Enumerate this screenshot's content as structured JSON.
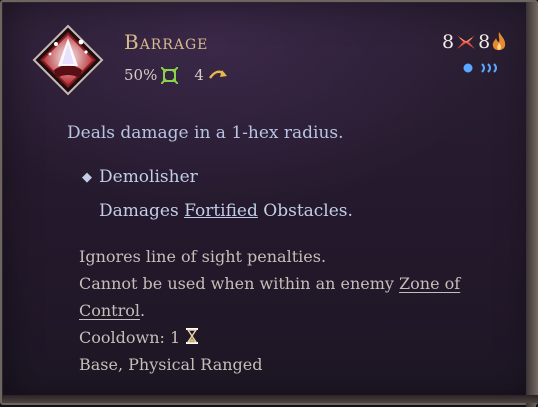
{
  "ability": {
    "title": "Barrage",
    "accuracy": "50%",
    "range": "4",
    "cost_ap": "8",
    "cost_focus": "8",
    "icon": "barrage-ability-icon",
    "accuracy_icon": "accuracy-crosshair-icon",
    "range_icon": "range-arc-icon",
    "ap_icon": "action-points-icon",
    "focus_icon": "focus-flame-icon",
    "speed_icon": "speed-pips-icon"
  },
  "description": "Deals damage in a 1-hex radius.",
  "trait": {
    "marker": "◆",
    "name": "Demolisher",
    "desc_before": "Damages ",
    "desc_link": "Fortified",
    "desc_after": " Obstacles."
  },
  "notes": {
    "line1": "Ignores line of sight penalties.",
    "line2_before": "Cannot be used when within an enemy ",
    "line2_link": "Zone of",
    "line3_link": "Control",
    "line3_after": ".",
    "cooldown": "Cooldown: 1",
    "cooldown_icon": "hourglass-icon",
    "tags": "Base, Physical Ranged"
  },
  "colors": {
    "title": "#d6b98c",
    "description": "#b9c4e2",
    "accuracy_icon": "#8bd14a",
    "range_icon": "#e7b84a",
    "ap_icon": "#e0503a",
    "focus_icon": "#e58a2e",
    "pip": "#5aa8ff"
  }
}
